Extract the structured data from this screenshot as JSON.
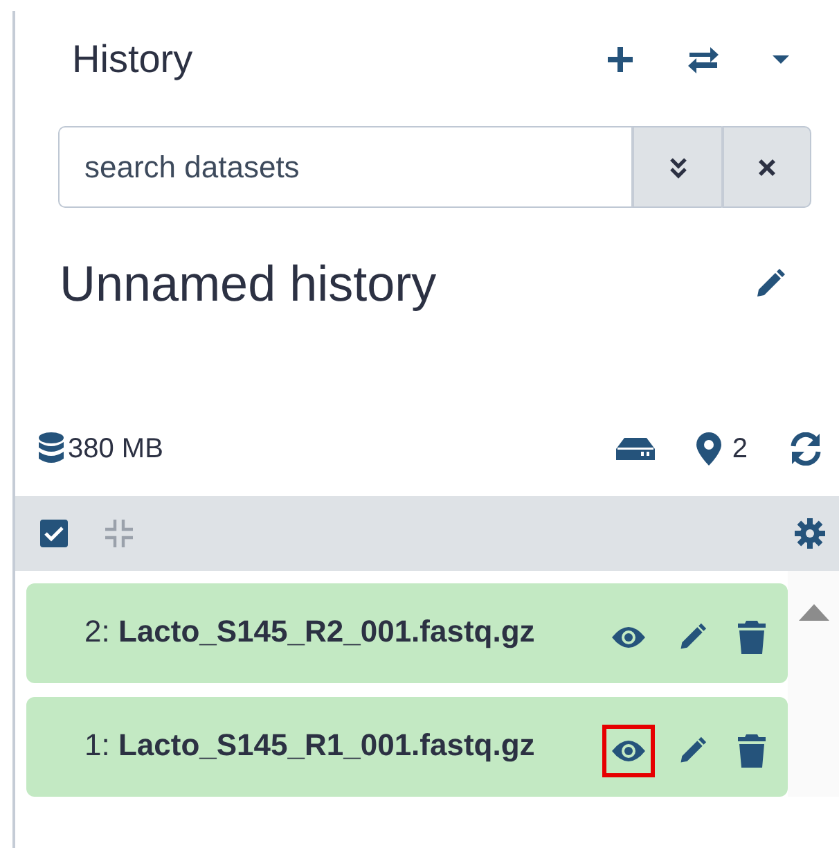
{
  "panel": {
    "title": "History"
  },
  "search": {
    "placeholder": "search datasets"
  },
  "history": {
    "name": "Unnamed history"
  },
  "stats": {
    "size": "380 MB",
    "pinned": "2"
  },
  "toolbar": {
    "select_all": true
  },
  "datasets": [
    {
      "label": "2: **Lacto_S145_R2_001.fastq.gz**",
      "highlighted": false
    },
    {
      "label": "1: **Lacto_S145_R1_001.fastq.gz**",
      "highlighted": true
    }
  ]
}
